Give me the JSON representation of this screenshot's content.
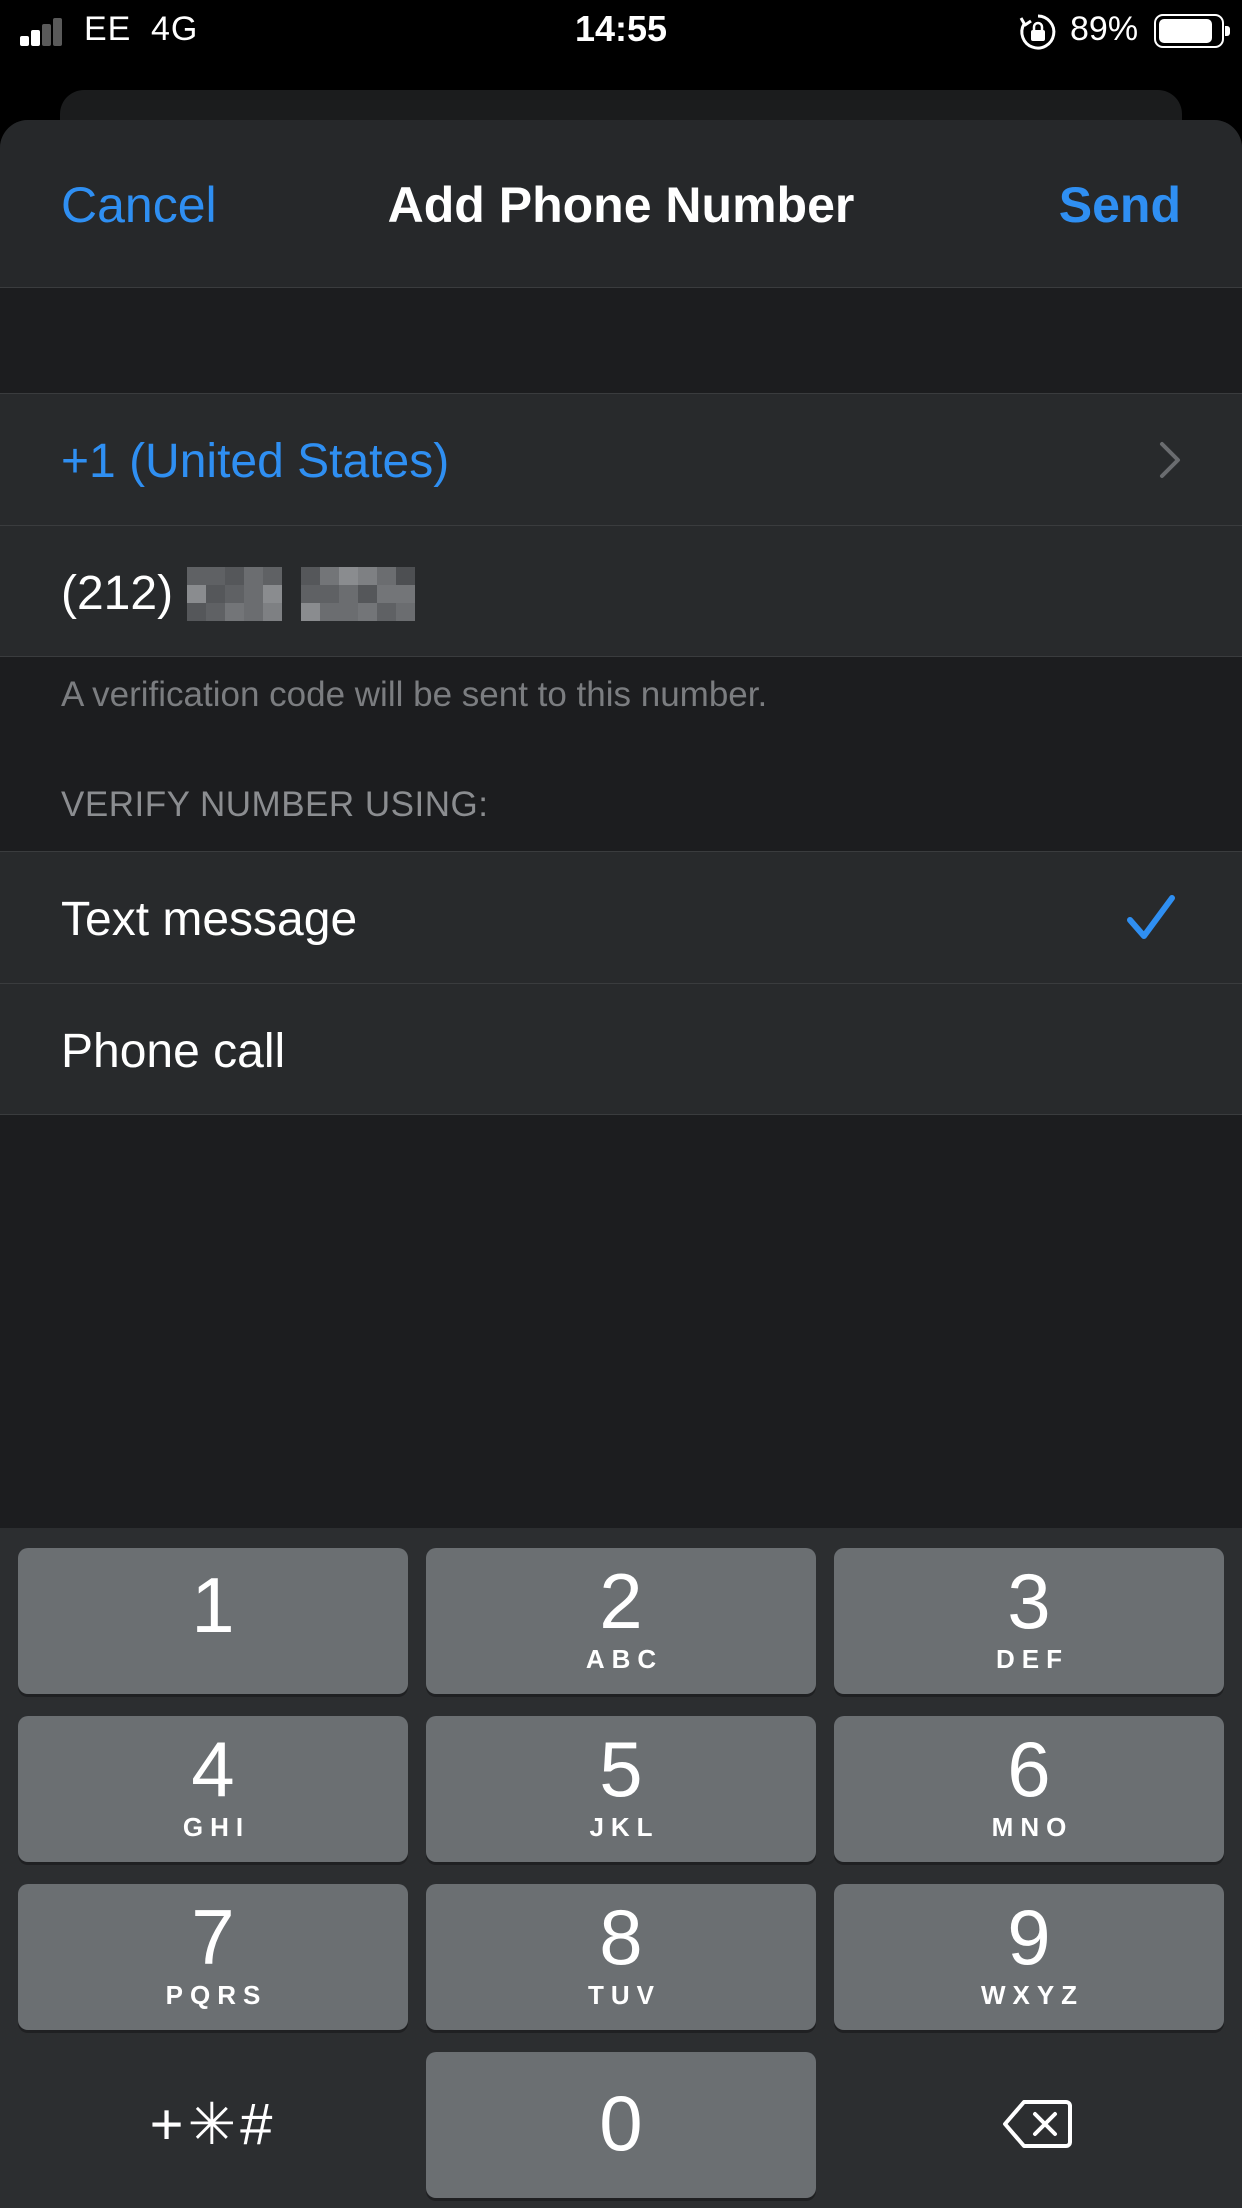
{
  "status_bar": {
    "carrier": "EE",
    "network": "4G",
    "time": "14:55",
    "battery_percent": "89%",
    "battery_level": 0.89,
    "signal_bars": 2,
    "icons": [
      "signal-icon",
      "orientation-lock-icon",
      "battery-icon"
    ]
  },
  "nav": {
    "cancel_label": "Cancel",
    "title": "Add Phone Number",
    "send_label": "Send"
  },
  "phone_form": {
    "country": "+1 (United States)",
    "phone_area_code": "(212)",
    "phone_rest_redacted": true,
    "footer_note": "A verification code will be sent to this number."
  },
  "verify": {
    "header": "VERIFY NUMBER USING:",
    "options": [
      {
        "label": "Text message",
        "selected": true
      },
      {
        "label": "Phone call",
        "selected": false
      }
    ]
  },
  "keypad": {
    "keys": [
      {
        "digit": "1",
        "letters": ""
      },
      {
        "digit": "2",
        "letters": "ABC"
      },
      {
        "digit": "3",
        "letters": "DEF"
      },
      {
        "digit": "4",
        "letters": "GHI"
      },
      {
        "digit": "5",
        "letters": "JKL"
      },
      {
        "digit": "6",
        "letters": "MNO"
      },
      {
        "digit": "7",
        "letters": "PQRS"
      },
      {
        "digit": "8",
        "letters": "TUV"
      },
      {
        "digit": "9",
        "letters": "WXYZ"
      },
      {
        "digit": "0",
        "letters": ""
      }
    ],
    "symbols_label": "+✳#",
    "delete_icon": "delete-backward-icon"
  },
  "colors": {
    "accent": "#2f8ff2",
    "sheet_background": "#1c1d1f",
    "row_background": "#282a2c",
    "key_background": "#6b6f72"
  }
}
